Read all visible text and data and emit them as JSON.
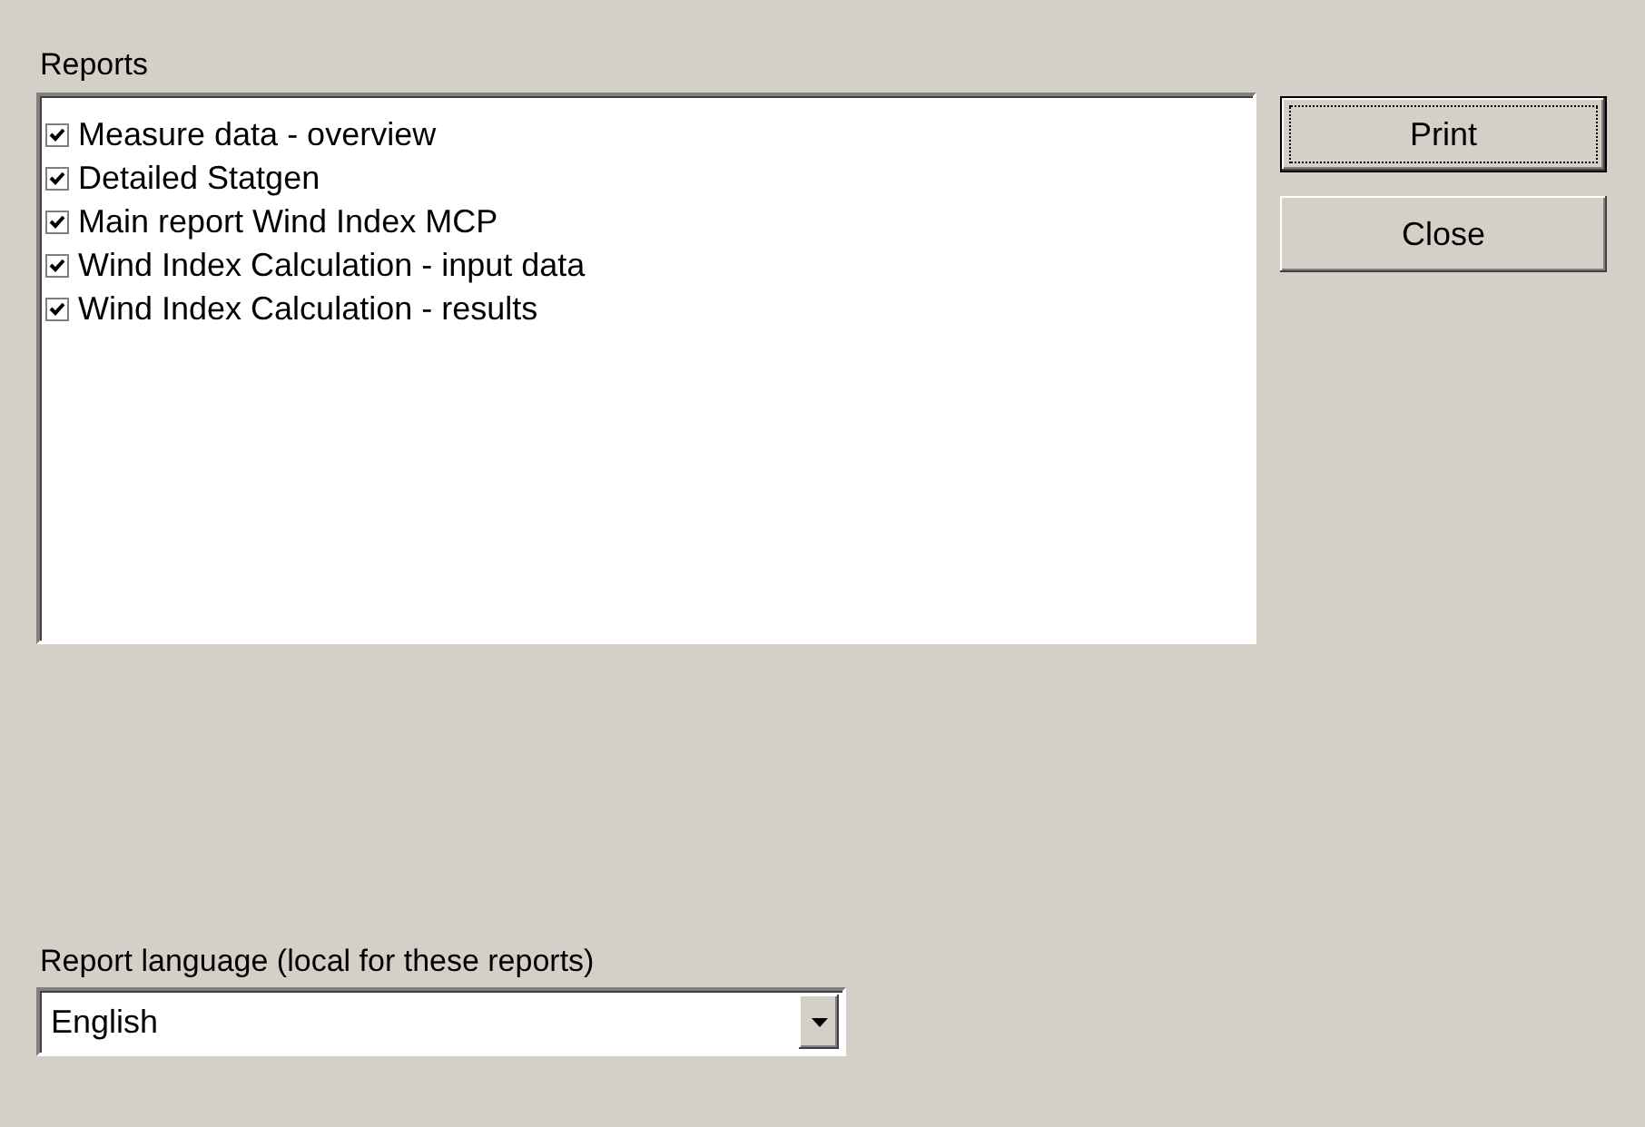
{
  "reports": {
    "label": "Reports",
    "items": [
      {
        "label": "Measure data - overview",
        "checked": true
      },
      {
        "label": "Detailed Statgen",
        "checked": true
      },
      {
        "label": "Main report Wind Index MCP",
        "checked": true
      },
      {
        "label": "Wind Index Calculation - input data",
        "checked": true
      },
      {
        "label": "Wind Index Calculation - results",
        "checked": true
      }
    ]
  },
  "buttons": [
    {
      "label": "Print",
      "focused": true
    },
    {
      "label": "Close",
      "focused": false
    }
  ],
  "language": {
    "label": "Report language (local for these reports)",
    "value": "English"
  }
}
